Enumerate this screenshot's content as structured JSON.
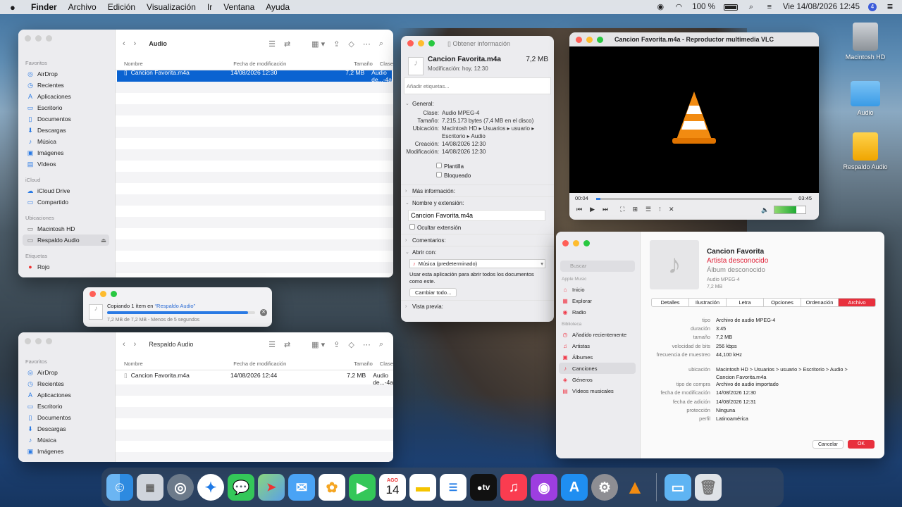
{
  "menubar": {
    "app": "Finder",
    "items": [
      "Archivo",
      "Edición",
      "Visualización",
      "Ir",
      "Ventana",
      "Ayuda"
    ],
    "battery": "100 %",
    "datetime": "Vie 14/08/2026  12:45",
    "notif": "4"
  },
  "finder1": {
    "title": "Audio",
    "sidebar": {
      "recents_label": "Favoritos",
      "favorites": [
        "AirDrop",
        "Recientes",
        "Aplicaciones",
        "Escritorio",
        "Documentos",
        "Descargas",
        "Música",
        "Imágenes",
        "Vídeos"
      ],
      "icloud_label": "iCloud",
      "icloud": [
        "iCloud Drive",
        "Compartido"
      ],
      "locations_label": "Ubicaciones",
      "locations": [
        "Macintosh HD",
        "Respaldo Audio"
      ],
      "tags_label": "Etiquetas",
      "tags": [
        "Rojo"
      ]
    },
    "columns": [
      "Nombre",
      "Fecha de modificación",
      "Tamaño",
      "Clase"
    ],
    "rows": [
      {
        "name": "Cancion Favorita.m4a",
        "date": "14/08/2026 12:30",
        "size": "7,2 MB",
        "kind": "Audio de...-4a"
      }
    ]
  },
  "copy": {
    "label": "Copiando 1 ítem en",
    "dest": "“Respaldo Audio”",
    "status": "7,2 MB de 7,2 MB - Menos de 5 segundos",
    "progress": 0.95
  },
  "finder2": {
    "title": "Respaldo Audio",
    "sidebar": {
      "favorites_label": "Favoritos",
      "favorites": [
        "AirDrop",
        "Recientes",
        "Aplicaciones",
        "Escritorio",
        "Documentos",
        "Descargas",
        "Música",
        "Imágenes"
      ]
    },
    "columns": [
      "Nombre",
      "Fecha de modificación",
      "Tamaño",
      "Clase"
    ],
    "rows": [
      {
        "name": "Cancion Favorita.m4a",
        "date": "14/08/2026 12:44",
        "size": "7,2 MB",
        "kind": "Audio de...-4a"
      }
    ]
  },
  "info": {
    "title": "Obtener información",
    "filename": "Cancion Favorita.m4a",
    "size": "7,2 MB",
    "modified": "Modificación:  hoy, 12:30",
    "tags_placeholder": "Añadir etiquetas...",
    "general": "General:",
    "rows": [
      [
        "Clase:",
        "Audio MPEG-4"
      ],
      [
        "Tamaño:",
        "7.215.173 bytes (7,4 MB en el disco)"
      ],
      [
        "Ubicación:",
        "Macintosh HD ▸ Usuarios ▸ usuario ▸"
      ],
      [
        "",
        "Escritorio ▸ Audio"
      ],
      [
        "Creación:",
        "14/08/2026  12:30"
      ],
      [
        "Modificación:",
        "14/08/2026  12:30"
      ]
    ],
    "template": "Plantilla",
    "locked": "Bloqueado",
    "more": "Más información:",
    "name_ext": "Nombre y extensión:",
    "name_value": "Cancion Favorita.m4a",
    "hide_ext": "Ocultar extensión",
    "comments": "Comentarios:",
    "open_with": "Abrir con:",
    "app": "Música (predeterminado)",
    "use_app": "Usar esta aplicación para abrir todos los documentos como este.",
    "change_all": "Cambiar todo...",
    "preview": "Vista previa:"
  },
  "vlc": {
    "title": "Cancion Favorita.m4a - Reproductor multimedia VLC",
    "elapsed": "00:04",
    "total": "03:45",
    "position": 0.02,
    "volume": 0.7
  },
  "music": {
    "search": "Buscar",
    "apple_music": "Apple Music",
    "am_items": [
      "Inicio",
      "Explorar",
      "Radio"
    ],
    "library": "Biblioteca",
    "lib_items": [
      "Añadido recientemente",
      "Artistas",
      "Álbumes",
      "Canciones",
      "Géneros",
      "Vídeos musicales"
    ],
    "song": "Cancion Favorita",
    "artist": "Artista desconocido",
    "album": "Álbum desconocido",
    "format": "Audio MPEG-4",
    "size": "7,2 MB",
    "tabs": [
      "Detalles",
      "Ilustración",
      "Letra",
      "Opciones",
      "Ordenación",
      "Archivo"
    ],
    "rows": [
      [
        "tipo",
        "Archivo de audio MPEG-4"
      ],
      [
        "duración",
        "3:45"
      ],
      [
        "tamaño",
        "7,2 MB"
      ],
      [
        "velocidad de bits",
        "256 kbps"
      ],
      [
        "frecuencia de muestreo",
        "44,100 kHz"
      ]
    ],
    "rows2": [
      [
        "ubicación",
        "Macintosh HD > Usuarios > usuario > Escritorio > Audio >"
      ],
      [
        "",
        "Cancion Favorita.m4a"
      ],
      [
        "tipo de compra",
        "Archivo de audio importado"
      ],
      [
        "fecha de modificación",
        "14/08/2026 12:30"
      ],
      [
        "fecha de adición",
        "14/08/2026 12:31"
      ],
      [
        "protección",
        "Ninguna"
      ],
      [
        "perfil",
        "Latinoamérica"
      ]
    ],
    "cancel": "Cancelar",
    "ok": "OK"
  },
  "desktop": [
    "Macintosh HD",
    "Audio",
    "Respaldo Audio"
  ],
  "dock": {
    "calendar_month": "AGO",
    "calendar_day": "14",
    "tv": "tv"
  }
}
